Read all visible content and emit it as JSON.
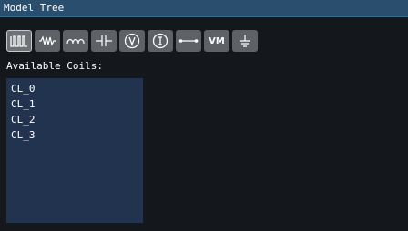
{
  "window": {
    "title": "Model Tree"
  },
  "toolbar": {
    "tools": [
      {
        "name": "inductor-coil",
        "icon": "coil-icon",
        "active": true
      },
      {
        "name": "resistor",
        "icon": "resistor-icon",
        "active": false
      },
      {
        "name": "inductor",
        "icon": "inductor-icon",
        "active": false
      },
      {
        "name": "capacitor",
        "icon": "capacitor-icon",
        "active": false
      },
      {
        "name": "voltage-source",
        "icon": "voltage-source-icon",
        "active": false
      },
      {
        "name": "current-source",
        "icon": "current-source-icon",
        "active": false
      },
      {
        "name": "wire",
        "icon": "wire-icon",
        "active": false
      },
      {
        "name": "voltmeter",
        "icon": "voltmeter-icon",
        "label": "VM",
        "active": false
      },
      {
        "name": "ground",
        "icon": "ground-icon",
        "active": false
      }
    ]
  },
  "coils": {
    "label": "Available Coils:",
    "items": [
      "CL_0",
      "CL_1",
      "CL_2",
      "CL_3"
    ]
  },
  "colors": {
    "background": "#14171c",
    "title_bar": "#2a4f6e",
    "button": "#5e6266",
    "list_background": "#22334f",
    "text": "#ffffff"
  }
}
